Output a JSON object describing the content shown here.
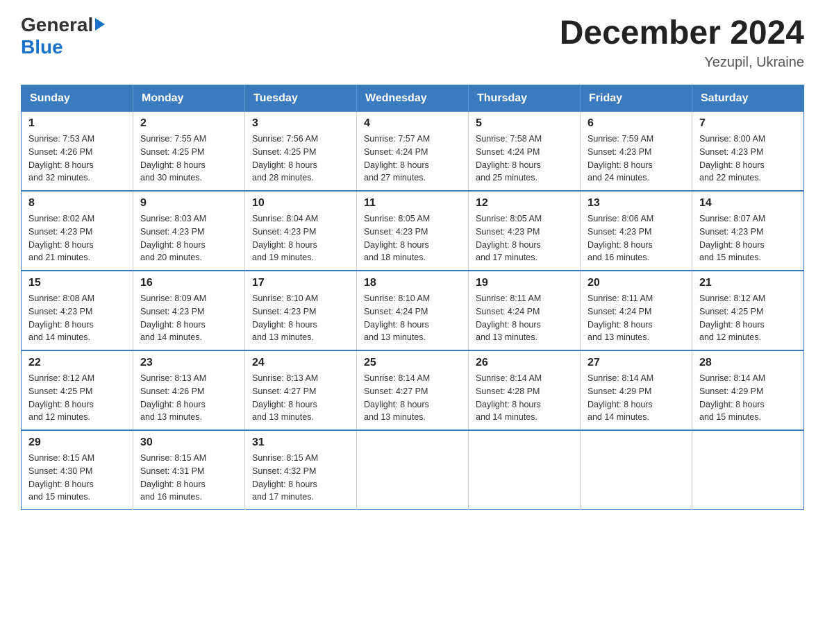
{
  "logo": {
    "general": "General",
    "blue": "Blue"
  },
  "header": {
    "title": "December 2024",
    "subtitle": "Yezupil, Ukraine"
  },
  "weekdays": [
    "Sunday",
    "Monday",
    "Tuesday",
    "Wednesday",
    "Thursday",
    "Friday",
    "Saturday"
  ],
  "weeks": [
    [
      {
        "day": "1",
        "sunrise": "7:53 AM",
        "sunset": "4:26 PM",
        "daylight": "8 hours and 32 minutes."
      },
      {
        "day": "2",
        "sunrise": "7:55 AM",
        "sunset": "4:25 PM",
        "daylight": "8 hours and 30 minutes."
      },
      {
        "day": "3",
        "sunrise": "7:56 AM",
        "sunset": "4:25 PM",
        "daylight": "8 hours and 28 minutes."
      },
      {
        "day": "4",
        "sunrise": "7:57 AM",
        "sunset": "4:24 PM",
        "daylight": "8 hours and 27 minutes."
      },
      {
        "day": "5",
        "sunrise": "7:58 AM",
        "sunset": "4:24 PM",
        "daylight": "8 hours and 25 minutes."
      },
      {
        "day": "6",
        "sunrise": "7:59 AM",
        "sunset": "4:23 PM",
        "daylight": "8 hours and 24 minutes."
      },
      {
        "day": "7",
        "sunrise": "8:00 AM",
        "sunset": "4:23 PM",
        "daylight": "8 hours and 22 minutes."
      }
    ],
    [
      {
        "day": "8",
        "sunrise": "8:02 AM",
        "sunset": "4:23 PM",
        "daylight": "8 hours and 21 minutes."
      },
      {
        "day": "9",
        "sunrise": "8:03 AM",
        "sunset": "4:23 PM",
        "daylight": "8 hours and 20 minutes."
      },
      {
        "day": "10",
        "sunrise": "8:04 AM",
        "sunset": "4:23 PM",
        "daylight": "8 hours and 19 minutes."
      },
      {
        "day": "11",
        "sunrise": "8:05 AM",
        "sunset": "4:23 PM",
        "daylight": "8 hours and 18 minutes."
      },
      {
        "day": "12",
        "sunrise": "8:05 AM",
        "sunset": "4:23 PM",
        "daylight": "8 hours and 17 minutes."
      },
      {
        "day": "13",
        "sunrise": "8:06 AM",
        "sunset": "4:23 PM",
        "daylight": "8 hours and 16 minutes."
      },
      {
        "day": "14",
        "sunrise": "8:07 AM",
        "sunset": "4:23 PM",
        "daylight": "8 hours and 15 minutes."
      }
    ],
    [
      {
        "day": "15",
        "sunrise": "8:08 AM",
        "sunset": "4:23 PM",
        "daylight": "8 hours and 14 minutes."
      },
      {
        "day": "16",
        "sunrise": "8:09 AM",
        "sunset": "4:23 PM",
        "daylight": "8 hours and 14 minutes."
      },
      {
        "day": "17",
        "sunrise": "8:10 AM",
        "sunset": "4:23 PM",
        "daylight": "8 hours and 13 minutes."
      },
      {
        "day": "18",
        "sunrise": "8:10 AM",
        "sunset": "4:24 PM",
        "daylight": "8 hours and 13 minutes."
      },
      {
        "day": "19",
        "sunrise": "8:11 AM",
        "sunset": "4:24 PM",
        "daylight": "8 hours and 13 minutes."
      },
      {
        "day": "20",
        "sunrise": "8:11 AM",
        "sunset": "4:24 PM",
        "daylight": "8 hours and 13 minutes."
      },
      {
        "day": "21",
        "sunrise": "8:12 AM",
        "sunset": "4:25 PM",
        "daylight": "8 hours and 12 minutes."
      }
    ],
    [
      {
        "day": "22",
        "sunrise": "8:12 AM",
        "sunset": "4:25 PM",
        "daylight": "8 hours and 12 minutes."
      },
      {
        "day": "23",
        "sunrise": "8:13 AM",
        "sunset": "4:26 PM",
        "daylight": "8 hours and 13 minutes."
      },
      {
        "day": "24",
        "sunrise": "8:13 AM",
        "sunset": "4:27 PM",
        "daylight": "8 hours and 13 minutes."
      },
      {
        "day": "25",
        "sunrise": "8:14 AM",
        "sunset": "4:27 PM",
        "daylight": "8 hours and 13 minutes."
      },
      {
        "day": "26",
        "sunrise": "8:14 AM",
        "sunset": "4:28 PM",
        "daylight": "8 hours and 14 minutes."
      },
      {
        "day": "27",
        "sunrise": "8:14 AM",
        "sunset": "4:29 PM",
        "daylight": "8 hours and 14 minutes."
      },
      {
        "day": "28",
        "sunrise": "8:14 AM",
        "sunset": "4:29 PM",
        "daylight": "8 hours and 15 minutes."
      }
    ],
    [
      {
        "day": "29",
        "sunrise": "8:15 AM",
        "sunset": "4:30 PM",
        "daylight": "8 hours and 15 minutes."
      },
      {
        "day": "30",
        "sunrise": "8:15 AM",
        "sunset": "4:31 PM",
        "daylight": "8 hours and 16 minutes."
      },
      {
        "day": "31",
        "sunrise": "8:15 AM",
        "sunset": "4:32 PM",
        "daylight": "8 hours and 17 minutes."
      },
      null,
      null,
      null,
      null
    ]
  ],
  "labels": {
    "sunrise": "Sunrise:",
    "sunset": "Sunset:",
    "daylight": "Daylight:"
  }
}
